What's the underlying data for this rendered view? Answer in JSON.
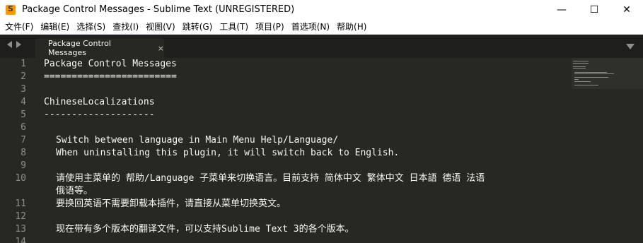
{
  "window": {
    "title": "Package Control Messages - Sublime Text (UNREGISTERED)",
    "minimize": "—",
    "maximize": "☐",
    "close": "✕"
  },
  "menu": [
    "文件(F)",
    "编辑(E)",
    "选择(S)",
    "查找(I)",
    "视图(V)",
    "跳转(G)",
    "工具(T)",
    "项目(P)",
    "首选项(N)",
    "帮助(H)"
  ],
  "tabs": {
    "active_label": "Package Control Messages",
    "close_glyph": "×"
  },
  "editor": {
    "lines": [
      {
        "num": "1",
        "text": "Package Control Messages",
        "indent": false
      },
      {
        "num": "2",
        "text": "========================",
        "indent": false
      },
      {
        "num": "3",
        "text": "",
        "indent": false
      },
      {
        "num": "4",
        "text": "ChineseLocalizations",
        "indent": false
      },
      {
        "num": "5",
        "text": "--------------------",
        "indent": false
      },
      {
        "num": "6",
        "text": "",
        "indent": false
      },
      {
        "num": "7",
        "text": "Switch between language in Main Menu Help/Language/",
        "indent": true
      },
      {
        "num": "8",
        "text": "When uninstalling this plugin, it will switch back to English.",
        "indent": true
      },
      {
        "num": "9",
        "text": "",
        "indent": false
      },
      {
        "num": "10",
        "text": "请使用主菜单的 帮助/Language 子菜单来切换语言。目前支持 简体中文 繁体中文 日本語 德语 法语",
        "indent": true
      },
      {
        "num": "",
        "text": "俄语等。",
        "indent": true
      },
      {
        "num": "11",
        "text": "要换回英语不需要卸载本插件，请直接从菜单切换英文。",
        "indent": true
      },
      {
        "num": "12",
        "text": "",
        "indent": false
      },
      {
        "num": "13",
        "text": "现在带有多个版本的翻译文件，可以支持Sublime Text 3的各个版本。",
        "indent": true
      },
      {
        "num": "14",
        "text": "",
        "indent": false
      }
    ]
  },
  "colors": {
    "editor_bg": "#272822",
    "tabbar_bg": "#1e1f1c",
    "text": "#f8f8f2",
    "gutter_text": "#90908a"
  }
}
